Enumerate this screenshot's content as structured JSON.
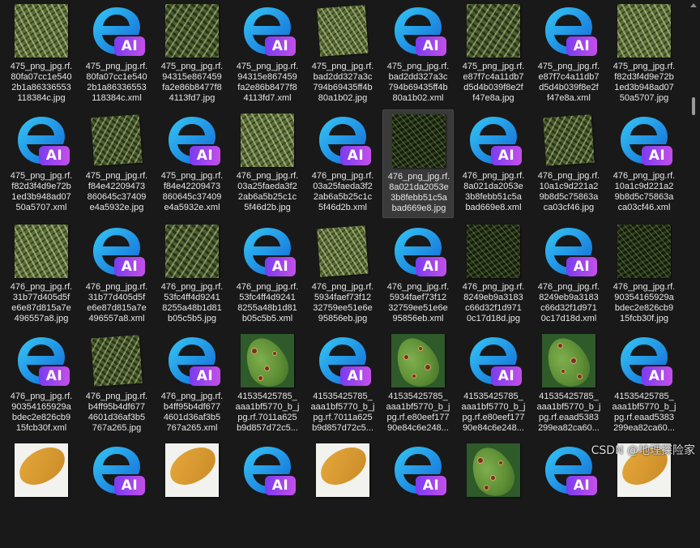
{
  "files": [
    {
      "name": "475_png_jpg.rf.80fa07cc1e5402b1a86336553118384c.jpg",
      "label": "475_png_jpg.rf.\n80fa07cc1e540\n2b1a86336553\n118384c.jpg",
      "kind": "grass-a",
      "selected": false
    },
    {
      "name": "475_png_jpg.rf.80fa07cc1e5402b1a86336553118384c.xml",
      "label": "475_png_jpg.rf.\n80fa07cc1e540\n2b1a86336553\n118384c.xml",
      "kind": "ai",
      "selected": false
    },
    {
      "name": "475_png_jpg.rf.94315ee867459fa2e86b8477f84113fd7.jpg",
      "label": "475_png_jpg.rf.\n94315e867459\nfa2e86b8477f8\n4113fd7.jpg",
      "kind": "grass-b",
      "selected": false
    },
    {
      "name": "475_png_jpg.rf.94315e867459fa2e86b8477f84113fd7.xml",
      "label": "475_png_jpg.rf.\n94315e867459\nfa2e86b8477f8\n4113fd7.xml",
      "kind": "ai",
      "selected": false
    },
    {
      "name": "475_png_jpg.rf.bad2dd327a3c794b69435ff4b80a1b02.jpg",
      "label": "475_png_jpg.rf.\nbad2dd327a3c\n794b69435ff4b\n80a1b02.jpg",
      "kind": "grass-a",
      "selected": false
    },
    {
      "name": "475_png_jpg.rf.bad2dd327a3c794b69435ff4b80a1b02.xml",
      "label": "475_png_jpg.rf.\nbad2dd327a3c\n794b69435ff4b\n80a1b02.xml",
      "kind": "ai",
      "selected": false
    },
    {
      "name": "475_png_jpg.rf.e87f7c4a11db7d5d4b039f8e2ff47e8a.jpg",
      "label": "475_png_jpg.rf.\ne87f7c4a11db7\nd5d4b039f8e2f\nf47e8a.jpg",
      "kind": "grass-b",
      "selected": false
    },
    {
      "name": "475_png_jpg.rf.e87f7c4a11db7d5d4b039f8e2ff47e8a.xml",
      "label": "475_png_jpg.rf.\ne87f7c4a11db7\nd5d4b039f8e2f\nf47e8a.xml",
      "kind": "ai",
      "selected": false
    },
    {
      "name": "475_png_jpg.rf.f82d3f4d9e72b1ed3b948ad0750a5707.jpg",
      "label": "475_png_jpg.rf.\nf82d3f4d9e72b\n1ed3b948ad07\n50a5707.jpg",
      "kind": "grass-a",
      "selected": false
    },
    {
      "name": "475_png_jpg.rf.f82d3f4d9e72b1ed3b948ad0750a5707.xml",
      "label": "475_png_jpg.rf.\nf82d3f4d9e72b\n1ed3b948ad07\n50a5707.xml",
      "kind": "ai",
      "selected": false
    },
    {
      "name": "475_png_jpg.rf.f84e42209473860645c37409e4a5932e.jpg",
      "label": "475_png_jpg.rf.\nf84e42209473\n860645c37409\ne4a5932e.jpg",
      "kind": "grass-b",
      "selected": false
    },
    {
      "name": "475_png_jpg.rf.f84e42209473860645c37409e4a5932e.xml",
      "label": "475_png_jpg.rf.\nf84e42209473\n860645c37409\ne4a5932e.xml",
      "kind": "ai",
      "selected": false
    },
    {
      "name": "476_png_jpg.rf.03a25faeda3f22ab6a5b25c1c5f46d2b.jpg",
      "label": "476_png_jpg.rf.\n03a25faeda3f2\n2ab6a5b25c1c\n5f46d2b.jpg",
      "kind": "grass-a",
      "selected": false
    },
    {
      "name": "476_png_jpg.rf.03a25faeda3f22ab6a5b25c1c5f46d2b.xml",
      "label": "476_png_jpg.rf.\n03a25faeda3f2\n2ab6a5b25c1c\n5f46d2b.xml",
      "kind": "ai",
      "selected": false
    },
    {
      "name": "476_png_jpg.rf.8a021da2053e3b8febb51c5abad669e8.jpg",
      "label": "476_png_jpg.rf.\n8a021da2053e\n3b8febb51c5a\nbad669e8.jpg",
      "kind": "grass-dark",
      "selected": true
    },
    {
      "name": "476_png_jpg.rf.8a021da2053e3b8febb51c5abad669e8.xml",
      "label": "476_png_jpg.rf.\n8a021da2053e\n3b8febb51c5a\nbad669e8.xml",
      "kind": "ai",
      "selected": false
    },
    {
      "name": "476_png_jpg.rf.10a1c9d221a29b8d5c75863aca03cf46.jpg",
      "label": "476_png_jpg.rf.\n10a1c9d221a2\n9b8d5c75863a\nca03cf46.jpg",
      "kind": "grass-b",
      "selected": false
    },
    {
      "name": "476_png_jpg.rf.10a1c9d221a29b8d5c75863aca03cf46.xml",
      "label": "476_png_jpg.rf.\n10a1c9d221a2\n9b8d5c75863a\nca03cf46.xml",
      "kind": "ai",
      "selected": false
    },
    {
      "name": "476_png_jpg.rf.31b77d405d5fe6e87d815a7e496557a8.jpg",
      "label": "476_png_jpg.rf.\n31b77d405d5f\ne6e87d815a7e\n496557a8.jpg",
      "kind": "grass-a",
      "selected": false
    },
    {
      "name": "476_png_jpg.rf.31b77d405d5fe6e87d815a7e496557a8.xml",
      "label": "476_png_jpg.rf.\n31b77d405d5f\ne6e87d815a7e\n496557a8.xml",
      "kind": "ai",
      "selected": false
    },
    {
      "name": "476_png_jpg.rf.53fc4ff4d92418255a48b1d81b05c5b5.jpg",
      "label": "476_png_jpg.rf.\n53fc4ff4d9241\n8255a48b1d81\nb05c5b5.jpg",
      "kind": "grass-b",
      "selected": false
    },
    {
      "name": "476_png_jpg.rf.53fc4ff4d92418255a48b1d81b05c5b5.xml",
      "label": "476_png_jpg.rf.\n53fc4ff4d9241\n8255a48b1d81\nb05c5b5.xml",
      "kind": "ai",
      "selected": false
    },
    {
      "name": "476_png_jpg.rf.5934faef73f1232759ee51e6e95856eb.jpg",
      "label": "476_png_jpg.rf.\n5934faef73f12\n32759ee51e6e\n95856eb.jpg",
      "kind": "grass-a",
      "selected": false
    },
    {
      "name": "476_png_jpg.rf.5934faef73f1232759ee51e6e95856eb.xml",
      "label": "476_png_jpg.rf.\n5934faef73f12\n32759ee51e6e\n95856eb.xml",
      "kind": "ai",
      "selected": false
    },
    {
      "name": "476_png_jpg.rf.8249eb9a3183c66d32f1d9710c17d18d.jpg",
      "label": "476_png_jpg.rf.\n8249eb9a3183\nc66d32f1d971\n0c17d18d.jpg",
      "kind": "grass-dark",
      "selected": false
    },
    {
      "name": "476_png_jpg.rf.8249eb9a3183c66d32f1d9710c17d18d.xml",
      "label": "476_png_jpg.rf.\n8249eb9a3183\nc66d32f1d971\n0c17d18d.xml",
      "kind": "ai",
      "selected": false
    },
    {
      "name": "476_png_jpg.rf.90354165929abdec2e826cb915fcb30f.jpg",
      "label": "476_png_jpg.rf.\n90354165929a\nbdec2e826cb9\n15fcb30f.jpg",
      "kind": "grass-dark",
      "selected": false
    },
    {
      "name": "476_png_jpg.rf.90354165929abdec2e826cb915fcb30f.xml",
      "label": "476_png_jpg.rf.\n90354165929a\nbdec2e826cb9\n15fcb30f.xml",
      "kind": "ai",
      "selected": false
    },
    {
      "name": "476_png_jpg.rf.b4ff95b4df6774601d36af3b5767a265.jpg",
      "label": "476_png_jpg.rf.\nb4ff95b4df677\n4601d36af3b5\n767a265.jpg",
      "kind": "grass-b",
      "selected": false
    },
    {
      "name": "476_png_jpg.rf.b4ff95b4df6774601d36af3b5767a265.xml",
      "label": "476_png_jpg.rf.\nb4ff95b4df677\n4601d36af3b5\n767a265.xml",
      "kind": "ai",
      "selected": false
    },
    {
      "name": "41535425785_aaa1bf5770_b_jpg.rf.7011a625b9d857d72c5.jpg",
      "label": "41535425785_\naaa1bf5770_b_j\npg.rf.7011a625\nb9d857d72c5...",
      "kind": "leaf",
      "selected": false
    },
    {
      "name": "41535425785_aaa1bf5770_b_jpg.rf.7011a625b9d857d72c5.xml",
      "label": "41535425785_\naaa1bf5770_b_j\npg.rf.7011a625\nb9d857d72c5...",
      "kind": "ai",
      "selected": false
    },
    {
      "name": "41535425785_aaa1bf5770_b_jpg.rf.e80eef17790e84c6e248.jpg",
      "label": "41535425785_\naaa1bf5770_b_j\npg.rf.e80eef177\n90e84c6e248...",
      "kind": "leaf",
      "selected": false
    },
    {
      "name": "41535425785_aaa1bf5770_b_jpg.rf.e80eef17790e84c6e248.xml",
      "label": "41535425785_\naaa1bf5770_b_j\npg.rf.e80eef177\n90e84c6e248...",
      "kind": "ai",
      "selected": false
    },
    {
      "name": "41535425785_aaa1bf5770_b_jpg.rf.eaad5383299ea82ca60.jpg",
      "label": "41535425785_\naaa1bf5770_b_j\npg.rf.eaad5383\n299ea82ca60...",
      "kind": "leaf",
      "selected": false
    },
    {
      "name": "41535425785_aaa1bf5770_b_jpg.rf.eaad5383299ea82ca60.xml",
      "label": "41535425785_\naaa1bf5770_b_j\npg.rf.eaad5383\n299ea82ca60...",
      "kind": "ai",
      "selected": false
    },
    {
      "name": "",
      "label": "",
      "kind": "leaf-yellow",
      "selected": false
    },
    {
      "name": "",
      "label": "",
      "kind": "ai",
      "selected": false
    },
    {
      "name": "",
      "label": "",
      "kind": "leaf-yellow",
      "selected": false
    },
    {
      "name": "",
      "label": "",
      "kind": "ai",
      "selected": false
    },
    {
      "name": "",
      "label": "",
      "kind": "leaf-yellow",
      "selected": false
    },
    {
      "name": "",
      "label": "",
      "kind": "ai",
      "selected": false
    },
    {
      "name": "",
      "label": "",
      "kind": "leaf",
      "selected": false
    },
    {
      "name": "",
      "label": "",
      "kind": "ai",
      "selected": false
    },
    {
      "name": "",
      "label": "",
      "kind": "leaf-yellow",
      "selected": false
    }
  ],
  "badge_text": "AI",
  "watermark": "CSDN @地理探险家",
  "colors": {
    "background": "#191919",
    "label_text": "#e6e6e6",
    "selected_bg": "#3a3a3a",
    "badge_start": "#7a3cf0",
    "badge_end": "#c44fe8"
  }
}
